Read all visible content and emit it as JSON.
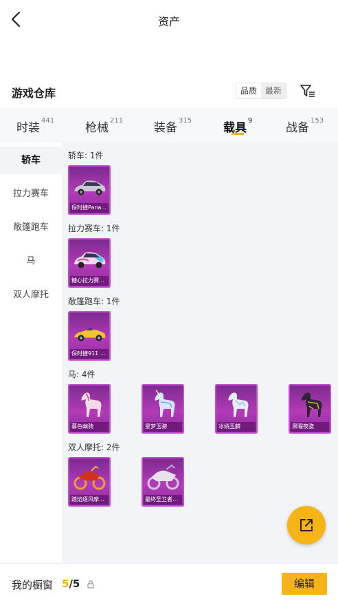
{
  "header": {
    "title": "资产"
  },
  "warehouse": {
    "title": "游戏仓库",
    "sort_options": [
      "品质",
      "最新"
    ],
    "active_sort": "最新"
  },
  "tabs": [
    {
      "label": "时装",
      "count": "441"
    },
    {
      "label": "枪械",
      "count": "211"
    },
    {
      "label": "装备",
      "count": "315"
    },
    {
      "label": "载具",
      "count": "9",
      "active": true
    },
    {
      "label": "战备",
      "count": "153"
    }
  ],
  "sidebar": {
    "items": [
      {
        "label": "轿车",
        "active": true
      },
      {
        "label": "拉力赛车"
      },
      {
        "label": "敞篷跑车"
      },
      {
        "label": "马"
      },
      {
        "label": "双人摩托"
      }
    ]
  },
  "sections": [
    {
      "title": "轿车: 1件",
      "items": [
        {
          "label": "保时捷Pana...",
          "art": "sedan-car-icon"
        }
      ]
    },
    {
      "title": "拉力赛车: 1件",
      "items": [
        {
          "label": "糖心拉力赛车...",
          "art": "rally-car-icon"
        }
      ]
    },
    {
      "title": "敞篷跑车: 1件",
      "items": [
        {
          "label": "保时捷911 敞...",
          "art": "convertible-car-icon"
        }
      ]
    },
    {
      "title": "马: 4件",
      "items": [
        {
          "label": "暮色幽骑",
          "art": "horse-icon"
        },
        {
          "label": "星梦玉骢",
          "art": "horse-icon"
        },
        {
          "label": "冰绡玉麟",
          "art": "horse-icon"
        },
        {
          "label": "黑曜夜骁",
          "art": "horse-icon"
        }
      ]
    },
    {
      "title": "双人摩托: 2件",
      "items": [
        {
          "label": "踏焰逐风摩托...",
          "art": "motorcycle-icon"
        },
        {
          "label": "最终圣卫者摩...",
          "art": "motorcycle-icon"
        }
      ]
    }
  ],
  "bottom": {
    "showcase_label": "我的橱窗",
    "showcase_current": "5",
    "showcase_total": "/5",
    "edit_label": "编辑"
  },
  "colors": {
    "accent": "#f6b417",
    "card_bg": "#9b33a8",
    "content_bg": "#f2f4f7"
  }
}
